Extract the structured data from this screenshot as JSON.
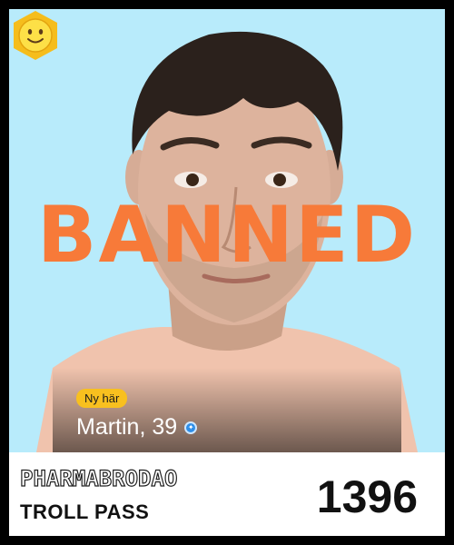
{
  "stamp": {
    "text": "BANNED"
  },
  "profile": {
    "new_badge": "Ny här",
    "name_age": "Martin, 39",
    "verified_icon": "verified-star-icon",
    "action_icon": "smiley-face-icon"
  },
  "footer": {
    "brand": "PHARMABRODAO",
    "pass_label": "TROLL PASS",
    "number": "1396"
  },
  "colors": {
    "background": "#b8ebfb",
    "stamp": "#f77a39",
    "badge": "#f8c01f",
    "verified": "#2e8ee8"
  }
}
